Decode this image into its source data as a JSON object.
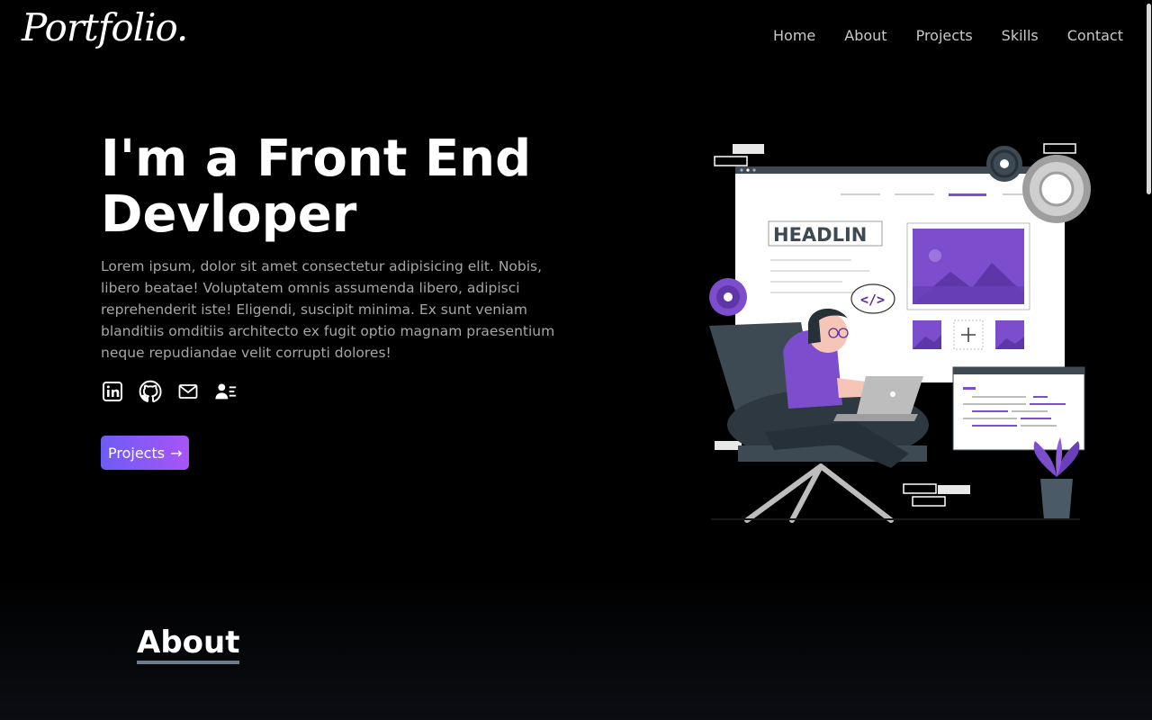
{
  "brand": {
    "logo_text": "Portfolio."
  },
  "nav": {
    "items": [
      {
        "label": "Home"
      },
      {
        "label": "About"
      },
      {
        "label": "Projects"
      },
      {
        "label": "Skills"
      },
      {
        "label": "Contact"
      }
    ]
  },
  "hero": {
    "title": "I'm a Front End Devloper",
    "description": "Lorem ipsum, dolor sit amet consectetur adipisicing elit. Nobis, libero beatae! Voluptatem omnis assumenda libero, adipisci reprehenderit iste! Eligendi, suscipit minima. Ex sunt veniam blanditiis omditiis architecto ex fugit optio magnam praesentium neque repudiandae velit corrupti dolores!",
    "socials": [
      {
        "icon": "linkedin-icon"
      },
      {
        "icon": "github-icon"
      },
      {
        "icon": "mail-icon"
      },
      {
        "icon": "contact-card-icon"
      }
    ],
    "cta_label": "Projects",
    "cta_arrow": "→"
  },
  "illustration": {
    "icon": "developer-illustration",
    "headline_text": "HEADLIN",
    "code_symbol": "</>"
  },
  "about": {
    "title": "About"
  },
  "colors": {
    "background": "#000000",
    "accent_start": "#6d5cf4",
    "accent_end": "#a855f7",
    "illustration_purple": "#7c4dcc",
    "underline": "#6b7c8f"
  }
}
